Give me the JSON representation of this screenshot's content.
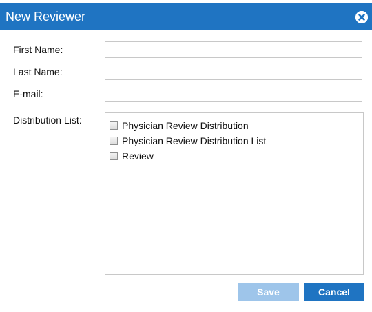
{
  "dialog": {
    "title": "New Reviewer",
    "close_icon": "close-circle-icon"
  },
  "form": {
    "first_name": {
      "label": "First Name:",
      "value": ""
    },
    "last_name": {
      "label": "Last Name:",
      "value": ""
    },
    "email": {
      "label": "E-mail:",
      "value": ""
    },
    "distribution_list": {
      "label": "Distribution List:",
      "options": [
        {
          "label": "Physician Review Distribution",
          "checked": false
        },
        {
          "label": "Physician Review Distribution List",
          "checked": false
        },
        {
          "label": "Review",
          "checked": false
        }
      ]
    }
  },
  "buttons": {
    "save_label": "Save",
    "save_disabled": true,
    "cancel_label": "Cancel"
  },
  "colors": {
    "accent": "#1f74c2",
    "save_disabled": "#9ec5ea"
  }
}
